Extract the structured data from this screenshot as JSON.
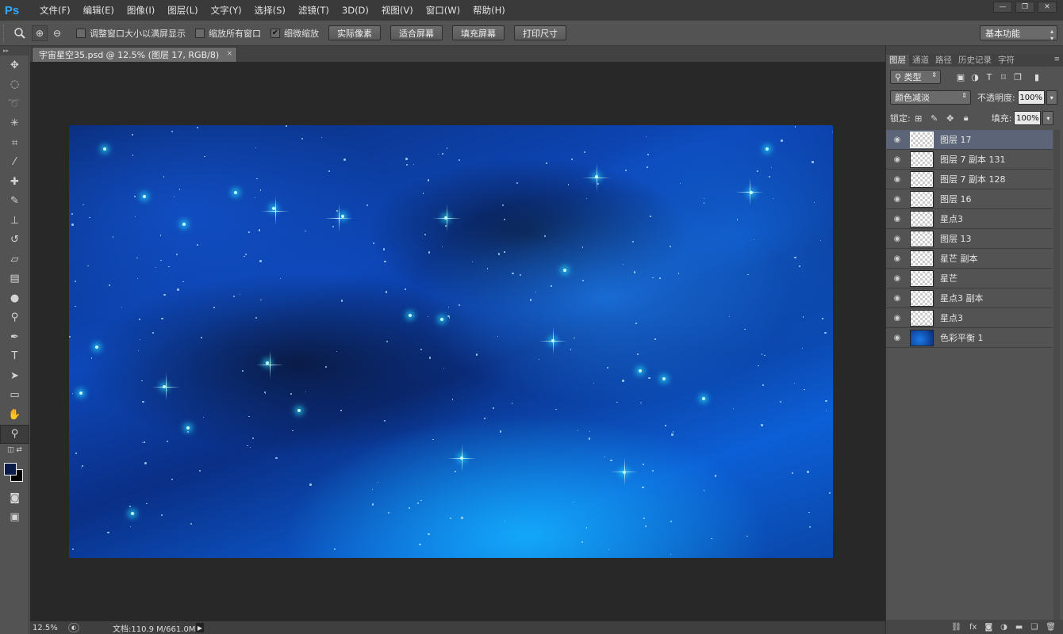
{
  "app": {
    "logo": "Ps"
  },
  "menubar": {
    "items": [
      "文件(F)",
      "编辑(E)",
      "图像(I)",
      "图层(L)",
      "文字(Y)",
      "选择(S)",
      "滤镜(T)",
      "3D(D)",
      "视图(V)",
      "窗口(W)",
      "帮助(H)"
    ],
    "window_controls": [
      "—",
      "❐",
      "✕"
    ]
  },
  "options_bar": {
    "tool_icon": "magnifier-icon",
    "zoom_in_icon": "⊕",
    "zoom_out_icon": "⊖",
    "checkboxes": [
      {
        "label": "调整窗口大小以满屏显示",
        "checked": false
      },
      {
        "label": "缩放所有窗口",
        "checked": false
      },
      {
        "label": "细微缩放",
        "checked": true
      }
    ],
    "buttons": [
      "实际像素",
      "适合屏幕",
      "填充屏幕",
      "打印尺寸"
    ],
    "workspace": "基本功能"
  },
  "document": {
    "tab_title": "宇宙星空35.psd @ 12.5% (图层 17, RGB/8)",
    "close": "×"
  },
  "statusbar": {
    "zoom": "12.5%",
    "doc_info": "文档:110.9 M/661.0M"
  },
  "layers_panel": {
    "tabs": [
      "图层",
      "通道",
      "路径",
      "历史记录",
      "字符"
    ],
    "active_tab": 0,
    "filter_kind": "类型",
    "blend_mode": "颜色减淡",
    "opacity_label": "不透明度:",
    "opacity_value": "100%",
    "lock_label": "锁定:",
    "fill_label": "填充:",
    "fill_value": "100%",
    "layers": [
      {
        "name": "图层 17",
        "selected": true,
        "thumb": "transparent"
      },
      {
        "name": "图层 7 副本 131",
        "selected": false,
        "thumb": "transparent"
      },
      {
        "name": "图层 7 副本 128",
        "selected": false,
        "thumb": "transparent"
      },
      {
        "name": "图层 16",
        "selected": false,
        "thumb": "transparent"
      },
      {
        "name": "星点3",
        "selected": false,
        "thumb": "transparent"
      },
      {
        "name": "图层 13",
        "selected": false,
        "thumb": "transparent"
      },
      {
        "name": "星芒 副本",
        "selected": false,
        "thumb": "transparent"
      },
      {
        "name": "星芒",
        "selected": false,
        "thumb": "transparent"
      },
      {
        "name": "星点3 副本",
        "selected": false,
        "thumb": "transparent"
      },
      {
        "name": "星点3",
        "selected": false,
        "thumb": "transparent"
      },
      {
        "name": "色彩平衡 1",
        "selected": false,
        "thumb": "image"
      }
    ],
    "bottom_icons": [
      "link-icon",
      "fx-icon",
      "mask-icon",
      "adjustment-icon",
      "group-icon",
      "new-layer-icon",
      "trash-icon"
    ]
  },
  "colors": {
    "accent": "#31a8ff",
    "foreground_swatch": "#0b1a46",
    "background_swatch": "#000000"
  }
}
